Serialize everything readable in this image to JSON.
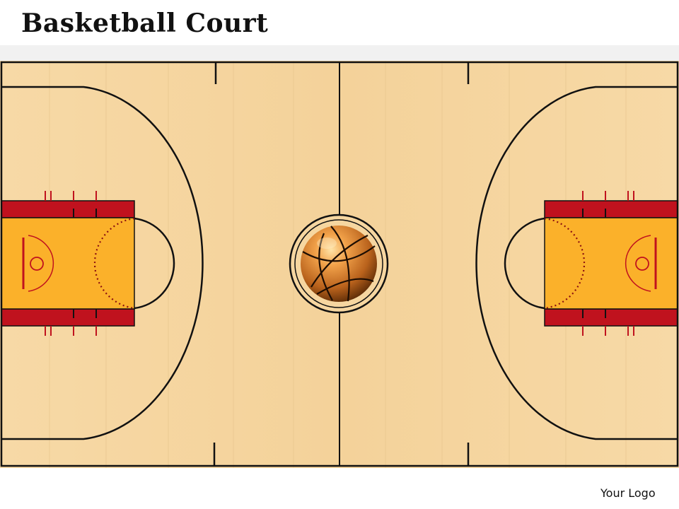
{
  "title": "Basketball Court",
  "logo_text": "Your Logo",
  "colors": {
    "floor": "#f6d6a0",
    "floor_grain": "#e9c48a",
    "key_fill": "#fbb12a",
    "lane_red": "#c0121e",
    "lines": "#111111",
    "title_band": "#f1f1f1"
  },
  "icons": {
    "ball": "basketball-icon",
    "hoop": "hoop-icon"
  }
}
